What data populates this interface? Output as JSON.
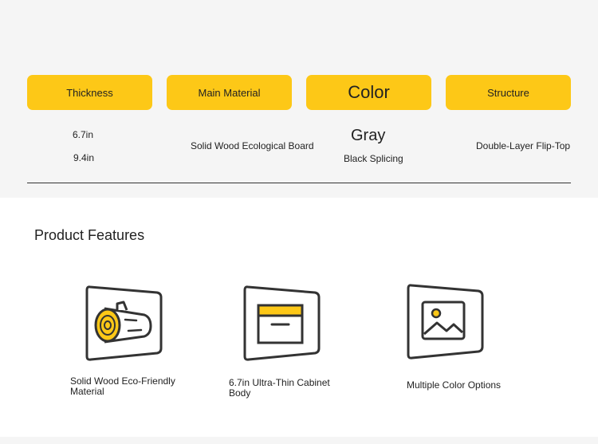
{
  "specs": {
    "thickness": {
      "label": "Thickness",
      "values": [
        "6.7in",
        "9.4in"
      ]
    },
    "material": {
      "label": "Main Material",
      "value": "Solid Wood Ecological Board"
    },
    "color": {
      "label": "Color",
      "values": [
        "Gray",
        "Black Splicing"
      ]
    },
    "structure": {
      "label": "Structure",
      "value": "Double-Layer Flip-Top"
    }
  },
  "features": {
    "title": "Product Features",
    "items": [
      {
        "label": "Solid Wood Eco-Friendly Material",
        "icon": "log-icon"
      },
      {
        "label": "6.7in Ultra-Thin Cabinet Body",
        "icon": "box-icon"
      },
      {
        "label": "Multiple Color Options",
        "icon": "image-icon"
      }
    ]
  },
  "colors": {
    "accent": "#fdc817",
    "outline": "#333333"
  }
}
